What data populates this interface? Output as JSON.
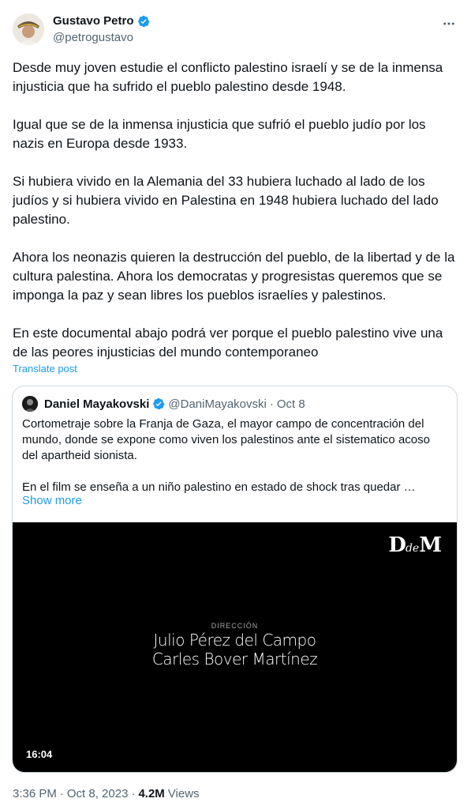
{
  "tweet": {
    "author_name": "Gustavo Petro",
    "author_handle": "@petrogustavo",
    "paragraphs": [
      "Desde muy joven estudie el conflicto palestino israelí y se de la inmensa injusticia que ha sufrido el pueblo palestino desde 1948.",
      "Igual que se de la inmensa injusticia  que sufrió el pueblo judío por los nazis en Europa desde 1933.",
      "Si hubiera vivido en la Alemania del 33 hubiera luchado al lado de los judíos y si hubiera vivido en Palestina en 1948 hubiera luchado del lado palestino.",
      "Ahora los neonazis quieren la destrucción del pueblo, de la libertad y de la cultura palestina. Ahora los democratas y progresistas queremos que se imponga la paz y sean libres los pueblos israelíes y palestinos.",
      "En este documental abajo podrá ver porque el pueblo palestino vive una de las peores injusticias del mundo contemporaneo"
    ],
    "translate_label": "Translate post",
    "time": "3:36 PM",
    "separator": "·",
    "date": "Oct 8, 2023",
    "views_count": "4.2M",
    "views_label": "Views"
  },
  "quote": {
    "author_name": "Daniel Mayakovski",
    "author_handle": "@DaniMayakovski",
    "separator": "·",
    "date": "Oct 8",
    "paragraphs": [
      "Cortometraje sobre la Franja de Gaza, el mayor campo de concentración del mundo, donde se expone como viven los palestinos ante el sistematico acoso del apartheid sionista.",
      "En el film se enseña a un niño palestino en estado de shock tras quedar …"
    ],
    "show_more_label": "Show more",
    "video": {
      "logo_d": "D",
      "logo_de": "de",
      "logo_m": "M",
      "credit_label": "DIRECCIÓN",
      "credit_line_1": "Julio Pérez del Campo",
      "credit_line_2": "Carles Bover Martínez",
      "duration": "16:04"
    }
  },
  "icons": {
    "verified": "verified-badge-icon",
    "more": "more-horizontal-icon"
  },
  "colors": {
    "accent": "#1d9bf0",
    "text": "#0f1419",
    "muted": "#536471",
    "border": "#cfd9de"
  }
}
